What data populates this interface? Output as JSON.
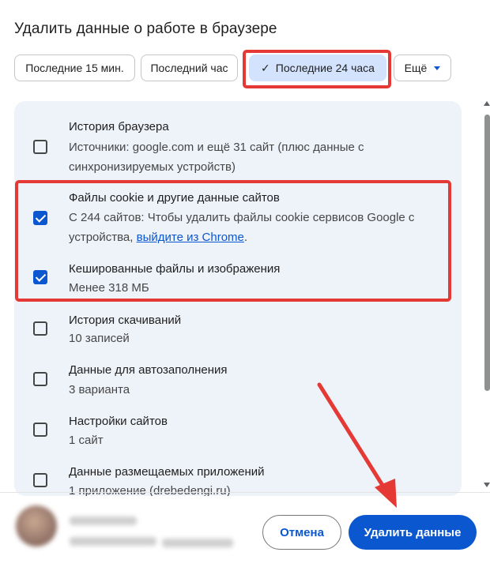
{
  "dialog": {
    "title": "Удалить данные о работе в браузере"
  },
  "time_range": {
    "options": [
      {
        "label": "Последние 15 мин.",
        "selected": false
      },
      {
        "label": "Последний час",
        "selected": false
      },
      {
        "label": "Последние 24 часа",
        "selected": true,
        "icon": "check-icon"
      }
    ],
    "more_label": "Ещё",
    "more_icon": "caret-down-icon"
  },
  "items": [
    {
      "title": "История браузера",
      "desc": "Источники: google.com и ещё 31 сайт (плюс данные с синхронизируемых устройств)",
      "checked": false
    },
    {
      "title": "Файлы cookie и другие данные сайтов",
      "desc_prefix": "С 244 сайтов: Чтобы удалить файлы cookie сервисов Google с устройства, ",
      "desc_link": "выйдите из Chrome",
      "desc_suffix": ".",
      "checked": true
    },
    {
      "title": "Кешированные файлы и изображения",
      "desc": "Менее 318 МБ",
      "checked": true
    },
    {
      "title": "История скачиваний",
      "desc": "10 записей",
      "checked": false
    },
    {
      "title": "Данные для автозаполнения",
      "desc": "3 варианта",
      "checked": false
    },
    {
      "title": "Настройки сайтов",
      "desc": "1 сайт",
      "checked": false
    },
    {
      "title": "Данные размещаемых приложений",
      "desc": "1 приложение (drebedengi.ru)",
      "checked": false
    }
  ],
  "footer": {
    "cancel_label": "Отмена",
    "delete_label": "Удалить данные"
  },
  "colors": {
    "accent": "#0b57d0",
    "selected_chip": "#d3e3fd",
    "panel": "#eef2f9",
    "annotation": "#e53935"
  }
}
